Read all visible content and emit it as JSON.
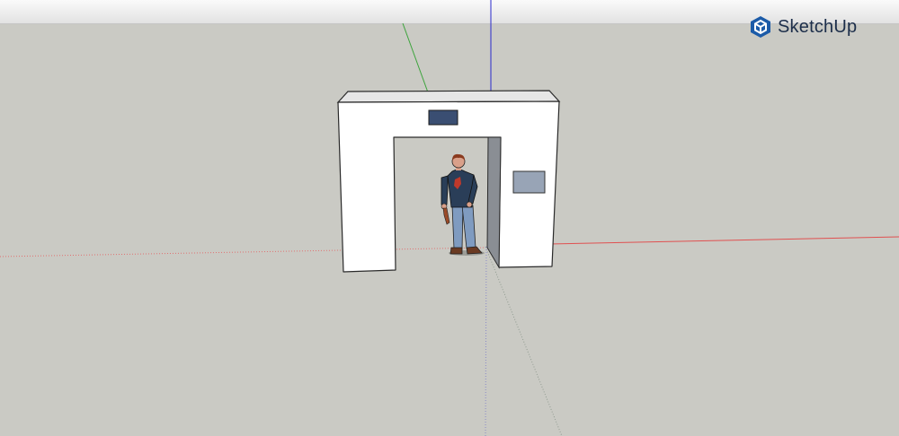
{
  "app": {
    "name": "SketchUp",
    "logo_icon": "sketchup-logo-icon"
  },
  "colors": {
    "ground": "#cacac4",
    "sky_top": "#fafafa",
    "red_axis": "#e05050",
    "green_axis": "#3aa33a",
    "blue_axis": "#2a2acc",
    "brand": "#1c5ba8"
  },
  "scene": {
    "objects": [
      "gate-model",
      "person-figure",
      "sign-panel-top",
      "sign-panel-side"
    ]
  }
}
